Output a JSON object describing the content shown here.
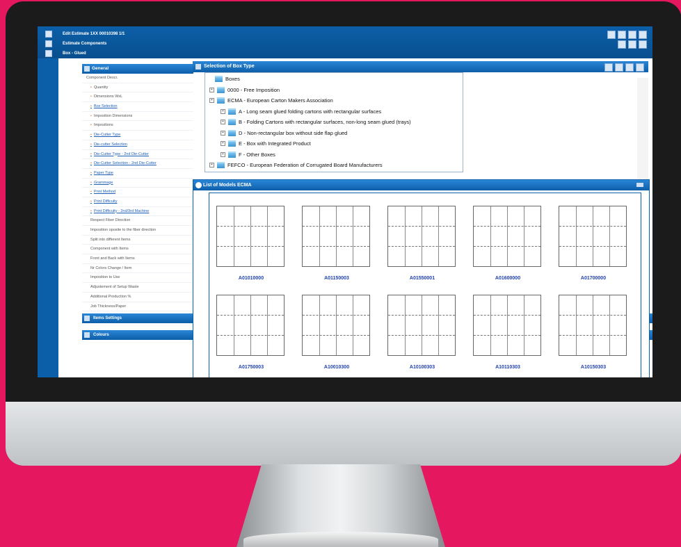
{
  "toolbar": {
    "row1": "Edit Estimate 1XX 00010398 1/1",
    "row2": "Estimate Components",
    "row3": "Box - Glued"
  },
  "general": {
    "title": "General",
    "items": [
      {
        "label": "Component Descr.",
        "link": false,
        "bullet": false
      },
      {
        "label": "Quantity",
        "link": false,
        "bullet": true
      },
      {
        "label": "Dimensions WxL",
        "link": false,
        "bullet": true
      },
      {
        "label": "Box Selection",
        "link": true,
        "bullet": true
      },
      {
        "label": "Imposition Dimensions",
        "link": false,
        "bullet": true
      },
      {
        "label": "Impositions",
        "link": false,
        "bullet": true
      },
      {
        "label": "Die-Cutter Type",
        "link": true,
        "bullet": true
      },
      {
        "label": "Die-cutter Selection",
        "link": true,
        "bullet": true
      },
      {
        "label": "Die-Cutter Type - 2nd Die-Cutter",
        "link": true,
        "bullet": true
      },
      {
        "label": "Die-Cutter Selection - 2nd Die-Cutter",
        "link": true,
        "bullet": true
      },
      {
        "label": "Paper Type",
        "link": true,
        "bullet": true
      },
      {
        "label": "Grammage",
        "link": true,
        "bullet": true
      },
      {
        "label": "Print Method",
        "link": true,
        "bullet": true
      },
      {
        "label": "Print Difficulty",
        "link": true,
        "bullet": true
      },
      {
        "label": "Print Difficulty - 2nd/3rd Machine",
        "link": true,
        "bullet": true
      },
      {
        "label": "Respect Fiber Direction",
        "link": false,
        "bullet": false
      },
      {
        "label": "Imposition oposite to the fiber direction",
        "link": false,
        "bullet": false
      },
      {
        "label": "Split into different Items",
        "link": false,
        "bullet": false
      },
      {
        "label": "Component with Items",
        "link": false,
        "bullet": false
      },
      {
        "label": "Front and Back with Items",
        "link": false,
        "bullet": false
      },
      {
        "label": "Nr Colors Change / Item",
        "link": false,
        "bullet": false
      },
      {
        "label": "Imposition to Use",
        "link": false,
        "bullet": false
      },
      {
        "label": "Adjustement of Setup Waste",
        "link": false,
        "bullet": false
      },
      {
        "label": "Additional Production %",
        "link": false,
        "bullet": false
      },
      {
        "label": "Job Thickness/Paper",
        "link": false,
        "bullet": false
      }
    ]
  },
  "sections": {
    "items_settings": "Items Settings",
    "colours": "Colours"
  },
  "selection": {
    "title": "Selection of Box Type",
    "tree": [
      {
        "label": "Boxes",
        "level": 0,
        "expander": false
      },
      {
        "label": "0000 - Free Imposition",
        "level": 1,
        "expander": true
      },
      {
        "label": "ECMA - European Carton Makers Association",
        "level": 1,
        "expander": true
      },
      {
        "label": "A - Long seam glued folding cartons with rectangular surfaces",
        "level": 2,
        "expander": true
      },
      {
        "label": "B - Folding Cartons with rectangular surfaces, non-long seam glued (trays)",
        "level": 2,
        "expander": true
      },
      {
        "label": "D - Non-rectangular box without side flap glued",
        "level": 2,
        "expander": true
      },
      {
        "label": "E - Box with Integrated Product",
        "level": 2,
        "expander": true
      },
      {
        "label": "F - Other Boxes",
        "level": 2,
        "expander": true
      },
      {
        "label": "FEFCO - European Federation of Corrugated Board Manufacturers",
        "level": 1,
        "expander": true
      }
    ]
  },
  "models": {
    "title": "List of Models ECMA",
    "items": [
      "A01010000",
      "A01150003",
      "A01550001",
      "A01600000",
      "A01700000",
      "A01750003",
      "A10010300",
      "A10100303",
      "A10110303",
      "A10150303"
    ]
  },
  "colors": {
    "background": "#e5175f",
    "accent": "#0d5ea9",
    "link": "#1d5fb6"
  }
}
